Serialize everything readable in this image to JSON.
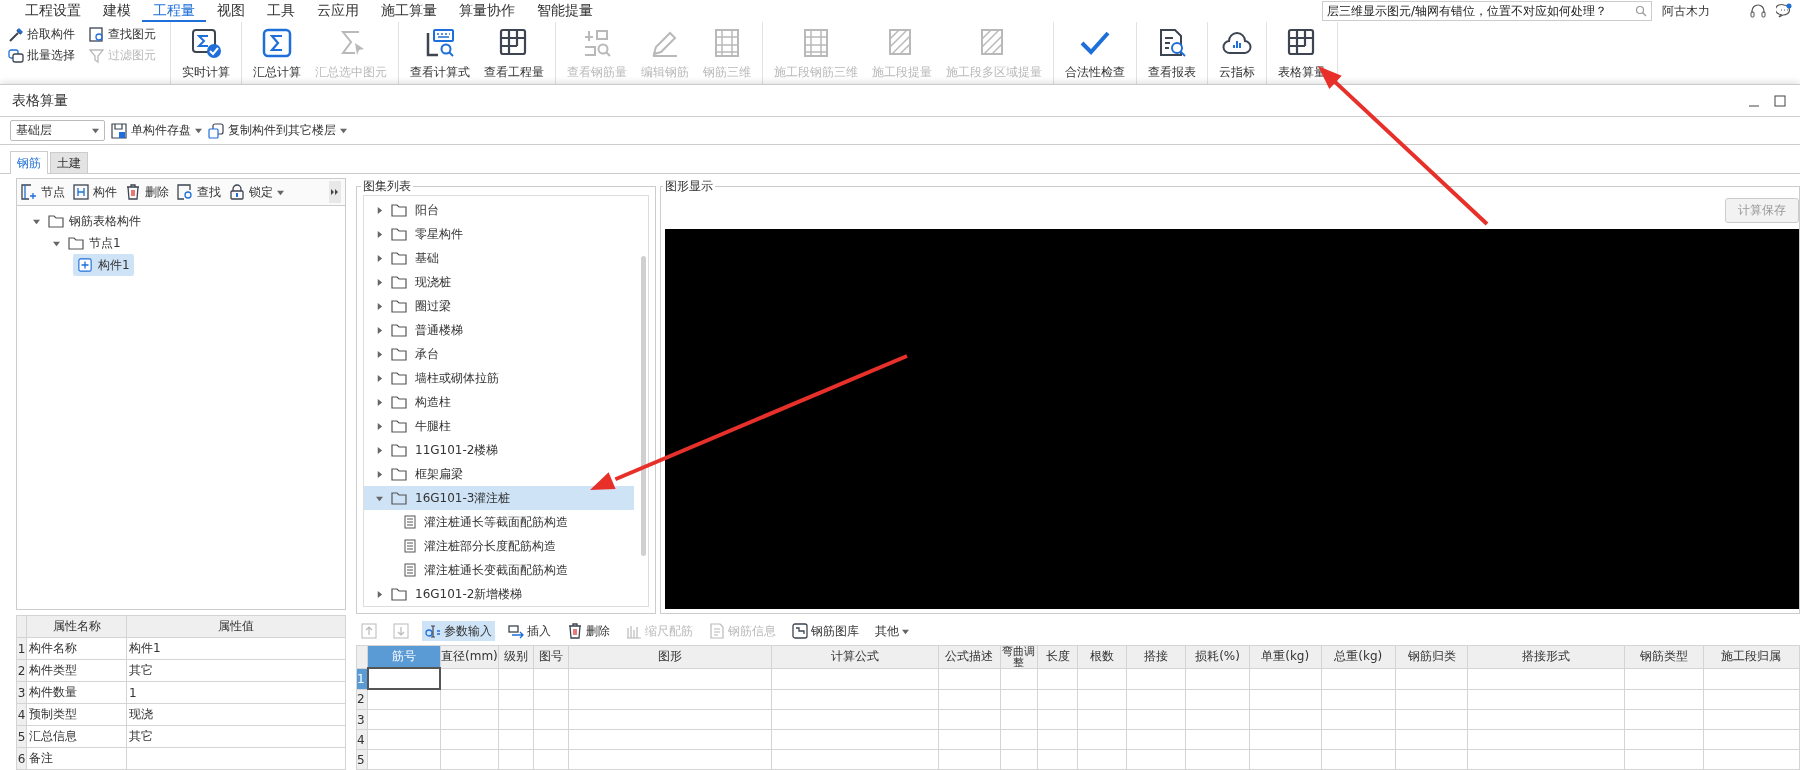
{
  "menu": {
    "items": [
      {
        "label": "工程设置",
        "selected": false
      },
      {
        "label": "建模",
        "selected": false
      },
      {
        "label": "工程量",
        "selected": true
      },
      {
        "label": "视图",
        "selected": false
      },
      {
        "label": "工具",
        "selected": false
      },
      {
        "label": "云应用",
        "selected": false
      },
      {
        "label": "施工算量",
        "selected": false
      },
      {
        "label": "算量协作",
        "selected": false
      },
      {
        "label": "智能提量",
        "selected": false
      }
    ]
  },
  "help_search": {
    "value": "层三维显示图元/轴网有错位，位置不对应如何处理？"
  },
  "user": {
    "name": "阿古木力"
  },
  "ribbon": {
    "groups": [
      {
        "kind": "small",
        "items": [
          {
            "label": "拾取构件",
            "disabled": false
          },
          {
            "label": "批量选择",
            "disabled": false
          },
          {
            "label": "查找图元",
            "disabled": false
          },
          {
            "label": "过滤图元",
            "disabled": true
          }
        ]
      },
      {
        "kind": "large",
        "items": [
          {
            "label": "实时计算",
            "disabled": false
          }
        ]
      },
      {
        "kind": "large",
        "items": [
          {
            "label": "汇总计算",
            "disabled": false
          },
          {
            "label": "汇总选中图元",
            "disabled": true
          }
        ]
      },
      {
        "kind": "large",
        "items": [
          {
            "label": "查看计算式",
            "disabled": false
          },
          {
            "label": "查看工程量",
            "disabled": false
          }
        ]
      },
      {
        "kind": "large",
        "items": [
          {
            "label": "查看钢筋量",
            "disabled": true
          },
          {
            "label": "编辑钢筋",
            "disabled": true
          },
          {
            "label": "钢筋三维",
            "disabled": true
          }
        ]
      },
      {
        "kind": "large",
        "items": [
          {
            "label": "施工段钢筋三维",
            "disabled": true
          },
          {
            "label": "施工段提量",
            "disabled": true
          },
          {
            "label": "施工段多区域提量",
            "disabled": true
          }
        ]
      },
      {
        "kind": "large",
        "items": [
          {
            "label": "合法性检查",
            "disabled": false
          }
        ]
      },
      {
        "kind": "large",
        "items": [
          {
            "label": "查看报表",
            "disabled": false
          }
        ]
      },
      {
        "kind": "large",
        "items": [
          {
            "label": "云指标",
            "disabled": false
          }
        ]
      },
      {
        "kind": "large",
        "items": [
          {
            "label": "表格算量",
            "disabled": false
          }
        ]
      }
    ]
  },
  "window": {
    "title": "表格算量"
  },
  "toolbar": {
    "floor": "基础层",
    "buttons": [
      {
        "label": "单构件存盘"
      },
      {
        "label": "复制构件到其它楼层"
      }
    ]
  },
  "tabs": [
    {
      "label": "钢筋",
      "selected": true
    },
    {
      "label": "土建",
      "selected": false
    }
  ],
  "tree_toolbar": [
    {
      "label": "节点",
      "dropdown": false
    },
    {
      "label": "构件",
      "dropdown": false
    },
    {
      "label": "删除",
      "dropdown": false
    },
    {
      "label": "查找",
      "dropdown": false
    },
    {
      "label": "锁定",
      "dropdown": true
    }
  ],
  "component_tree": [
    {
      "label": "钢筋表格构件",
      "expanded": true,
      "selected": false,
      "children": [
        {
          "label": "节点1",
          "expanded": true,
          "selected": false,
          "children": [
            {
              "label": "构件1",
              "selected": true
            }
          ]
        }
      ]
    }
  ],
  "properties": {
    "columns": [
      "属性名称",
      "属性值"
    ],
    "rows": [
      {
        "index": "1",
        "name": "构件名称",
        "value": "构件1"
      },
      {
        "index": "2",
        "name": "构件类型",
        "value": "其它"
      },
      {
        "index": "3",
        "name": "构件数量",
        "value": "1"
      },
      {
        "index": "4",
        "name": "预制类型",
        "value": "现浇"
      },
      {
        "index": "5",
        "name": "汇总信息",
        "value": "其它"
      },
      {
        "index": "6",
        "name": "备注"
      }
    ]
  },
  "atlas": {
    "title": "图集列表",
    "items": [
      {
        "label": "阳台",
        "expanded": false,
        "selected": false
      },
      {
        "label": "零星构件",
        "expanded": false,
        "selected": false
      },
      {
        "label": "基础",
        "expanded": false,
        "selected": false
      },
      {
        "label": "现浇桩",
        "expanded": false,
        "selected": false
      },
      {
        "label": "圈过梁",
        "expanded": false,
        "selected": false
      },
      {
        "label": "普通楼梯",
        "expanded": false,
        "selected": false
      },
      {
        "label": "承台",
        "expanded": false,
        "selected": false
      },
      {
        "label": "墙柱或砌体拉筋",
        "expanded": false,
        "selected": false
      },
      {
        "label": "构造柱",
        "expanded": false,
        "selected": false
      },
      {
        "label": "牛腿柱",
        "expanded": false,
        "selected": false
      },
      {
        "label": "11G101-2楼梯",
        "expanded": false,
        "selected": false
      },
      {
        "label": "框架扁梁",
        "expanded": false,
        "selected": false
      },
      {
        "label": "16G101-3灌注桩",
        "expanded": true,
        "selected": true,
        "children": [
          {
            "label": "灌注桩通长等截面配筋构造",
            "selected": false
          },
          {
            "label": "灌注桩部分长度配筋构造",
            "selected": false
          },
          {
            "label": "灌注桩通长变截面配筋构造",
            "selected": false
          }
        ]
      },
      {
        "label": "16G101-2新增楼梯",
        "expanded": false,
        "selected": false
      }
    ]
  },
  "graphic": {
    "title": "图形显示",
    "save_button": {
      "label": "计算保存",
      "disabled": true
    }
  },
  "rebar_toolbar": [
    {
      "kind": "move_up",
      "disabled": true,
      "selected": false
    },
    {
      "kind": "move_down",
      "disabled": true,
      "selected": false
    },
    {
      "kind": "params",
      "label": "参数输入",
      "disabled": false,
      "selected": true
    },
    {
      "kind": "insert",
      "label": "插入",
      "disabled": false,
      "selected": false
    },
    {
      "kind": "delete",
      "label": "删除",
      "disabled": false,
      "selected": false
    },
    {
      "kind": "scale",
      "label": "缩尺配筋",
      "disabled": true,
      "selected": false
    },
    {
      "kind": "info",
      "label": "钢筋信息",
      "disabled": true,
      "selected": false
    },
    {
      "kind": "library",
      "label": "钢筋图库",
      "disabled": false,
      "selected": false
    },
    {
      "kind": "menu",
      "label": "其他",
      "disabled": false,
      "selected": false
    }
  ],
  "rebar_table": {
    "columns": [
      "筋号",
      "直径(mm)",
      "级别",
      "图号",
      "图形",
      "计算公式",
      "公式描述",
      "弯曲调整",
      "长度",
      "根数",
      "搭接",
      "损耗(%)",
      "单重(kg)",
      "总重(kg)",
      "钢筋归类",
      "搭接形式",
      "钢筋类型",
      "施工段归属"
    ],
    "rows": [
      {
        "index": "1",
        "selected": true
      },
      {
        "index": "2",
        "selected": false
      },
      {
        "index": "3",
        "selected": false
      },
      {
        "index": "4",
        "selected": false
      },
      {
        "index": "5",
        "selected": false
      }
    ]
  }
}
